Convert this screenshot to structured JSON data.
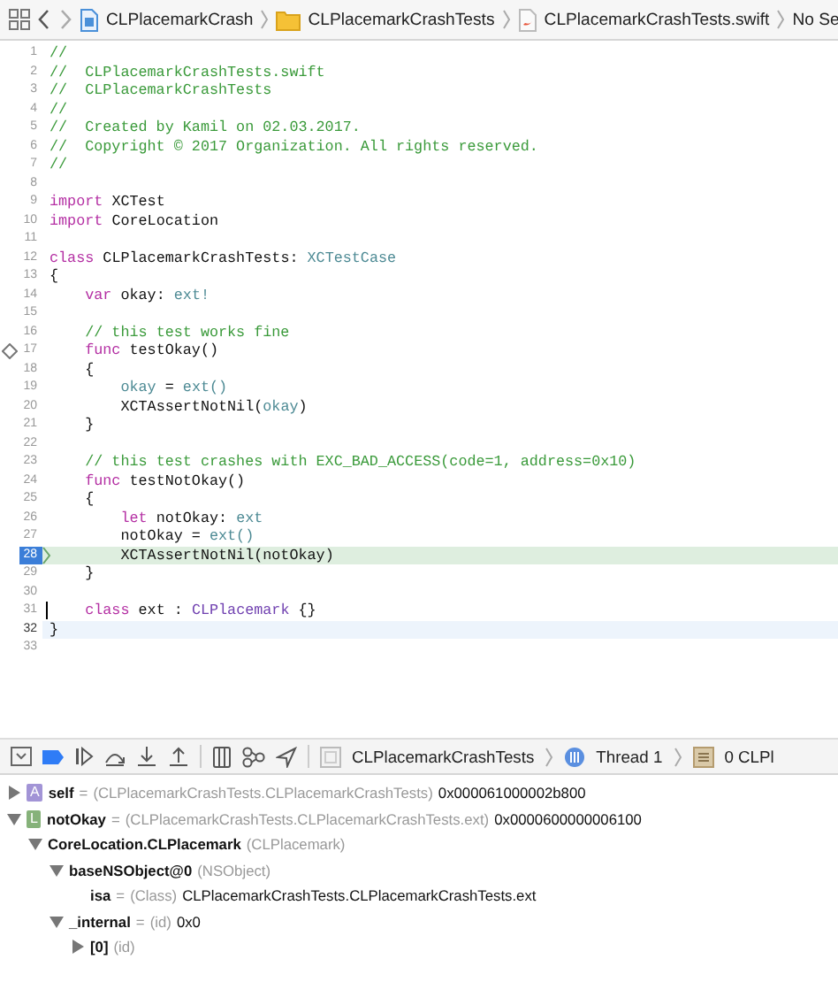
{
  "jump_bar": {
    "items": [
      {
        "kind": "project",
        "label": "CLPlacemarkCrash"
      },
      {
        "kind": "folder",
        "label": "CLPlacemarkCrashTests"
      },
      {
        "kind": "swift",
        "label": "CLPlacemarkCrashTests.swift"
      },
      {
        "kind": "plain",
        "label": "No Se"
      }
    ]
  },
  "editor": {
    "lines": [
      {
        "number": "1",
        "current": false,
        "focused": false,
        "test": false,
        "caret": false,
        "tokens": [
          {
            "kind": "comment",
            "text": "//"
          }
        ]
      },
      {
        "number": "2",
        "current": false,
        "focused": false,
        "test": false,
        "caret": false,
        "tokens": [
          {
            "kind": "comment",
            "text": "//  CLPlacemarkCrashTests.swift"
          }
        ]
      },
      {
        "number": "3",
        "current": false,
        "focused": false,
        "test": false,
        "caret": false,
        "tokens": [
          {
            "kind": "comment",
            "text": "//  CLPlacemarkCrashTests"
          }
        ]
      },
      {
        "number": "4",
        "current": false,
        "focused": false,
        "test": false,
        "caret": false,
        "tokens": [
          {
            "kind": "comment",
            "text": "//"
          }
        ]
      },
      {
        "number": "5",
        "current": false,
        "focused": false,
        "test": false,
        "caret": false,
        "tokens": [
          {
            "kind": "comment",
            "text": "//  Created by Kamil on 02.03.2017."
          }
        ]
      },
      {
        "number": "6",
        "current": false,
        "focused": false,
        "test": false,
        "caret": false,
        "tokens": [
          {
            "kind": "comment",
            "text": "//  Copyright © 2017 Organization. All rights reserved."
          }
        ]
      },
      {
        "number": "7",
        "current": false,
        "focused": false,
        "test": false,
        "caret": false,
        "tokens": [
          {
            "kind": "comment",
            "text": "//"
          }
        ]
      },
      {
        "number": "8",
        "current": false,
        "focused": false,
        "test": false,
        "caret": false
      },
      {
        "number": "9",
        "current": false,
        "focused": false,
        "test": false,
        "caret": false,
        "tokens": [
          {
            "kind": "keyword",
            "text": "import"
          },
          {
            "kind": "plain",
            "text": " XCTest"
          }
        ]
      },
      {
        "number": "10",
        "current": false,
        "focused": false,
        "test": false,
        "caret": false,
        "tokens": [
          {
            "kind": "keyword",
            "text": "import"
          },
          {
            "kind": "plain",
            "text": " CoreLocation"
          }
        ]
      },
      {
        "number": "11",
        "current": false,
        "focused": false,
        "test": false,
        "caret": false
      },
      {
        "number": "12",
        "current": false,
        "focused": false,
        "test": false,
        "caret": false,
        "tokens": [
          {
            "kind": "keyword",
            "text": "class"
          },
          {
            "kind": "plain",
            "text": " CLPlacemarkCrashTests:"
          },
          {
            "kind": "type",
            "text": " XCTestCase"
          }
        ]
      },
      {
        "number": "13",
        "current": false,
        "focused": false,
        "test": false,
        "caret": false,
        "tokens": [
          {
            "kind": "plain",
            "text": "{"
          }
        ]
      },
      {
        "number": "14",
        "current": false,
        "focused": false,
        "test": false,
        "caret": false,
        "tokens": [
          {
            "kind": "keyword",
            "text": "    var"
          },
          {
            "kind": "plain",
            "text": " okay:"
          },
          {
            "kind": "type",
            "text": " ext!"
          }
        ]
      },
      {
        "number": "15",
        "current": false,
        "focused": false,
        "test": false,
        "caret": false
      },
      {
        "number": "16",
        "current": false,
        "focused": false,
        "test": false,
        "caret": false,
        "tokens": [
          {
            "kind": "comment",
            "text": "    // this test works fine"
          }
        ]
      },
      {
        "number": "17",
        "current": false,
        "focused": false,
        "test": true,
        "caret": false,
        "tokens": [
          {
            "kind": "keyword",
            "text": "    func"
          },
          {
            "kind": "plain",
            "text": " testOkay()"
          }
        ]
      },
      {
        "number": "18",
        "current": false,
        "focused": false,
        "test": false,
        "caret": false,
        "tokens": [
          {
            "kind": "plain",
            "text": "    {"
          }
        ]
      },
      {
        "number": "19",
        "current": false,
        "focused": false,
        "test": false,
        "caret": false,
        "tokens": [
          {
            "kind": "type",
            "text": "        okay"
          },
          {
            "kind": "plain",
            "text": " ="
          },
          {
            "kind": "type",
            "text": " ext()"
          }
        ]
      },
      {
        "number": "20",
        "current": false,
        "focused": false,
        "test": false,
        "caret": false,
        "tokens": [
          {
            "kind": "plain",
            "text": "        XCTAssertNotNil("
          },
          {
            "kind": "type",
            "text": "okay"
          },
          {
            "kind": "plain",
            "text": ")"
          }
        ]
      },
      {
        "number": "21",
        "current": false,
        "focused": false,
        "test": false,
        "caret": false,
        "tokens": [
          {
            "kind": "plain",
            "text": "    }"
          }
        ]
      },
      {
        "number": "22",
        "current": false,
        "focused": false,
        "test": false,
        "caret": false
      },
      {
        "number": "23",
        "current": false,
        "focused": false,
        "test": false,
        "caret": false,
        "tokens": [
          {
            "kind": "comment",
            "text": "    // this test crashes with EXC_BAD_ACCESS(code=1, address=0x10)"
          }
        ]
      },
      {
        "number": "24",
        "current": false,
        "focused": false,
        "test": false,
        "caret": false,
        "tokens": [
          {
            "kind": "keyword",
            "text": "    func"
          },
          {
            "kind": "plain",
            "text": " testNotOkay()"
          }
        ]
      },
      {
        "number": "25",
        "current": false,
        "focused": false,
        "test": false,
        "caret": false,
        "tokens": [
          {
            "kind": "plain",
            "text": "    {"
          }
        ]
      },
      {
        "number": "26",
        "current": false,
        "focused": false,
        "test": false,
        "caret": false,
        "tokens": [
          {
            "kind": "keyword",
            "text": "        let"
          },
          {
            "kind": "plain",
            "text": " notOkay:"
          },
          {
            "kind": "type",
            "text": " ext"
          }
        ]
      },
      {
        "number": "27",
        "current": false,
        "focused": false,
        "test": false,
        "caret": false,
        "tokens": [
          {
            "kind": "plain",
            "text": "        notOkay ="
          },
          {
            "kind": "type",
            "text": " ext()"
          }
        ]
      },
      {
        "number": "28",
        "current": true,
        "focused": false,
        "test": false,
        "caret": false,
        "tokens": [
          {
            "kind": "plain",
            "text": "        XCTAssertNotNil(notOkay)"
          }
        ]
      },
      {
        "number": "29",
        "current": false,
        "focused": false,
        "test": false,
        "caret": false,
        "tokens": [
          {
            "kind": "plain",
            "text": "    }"
          }
        ]
      },
      {
        "number": "30",
        "current": false,
        "focused": false,
        "test": false,
        "caret": false
      },
      {
        "number": "31",
        "current": false,
        "focused": false,
        "test": false,
        "caret": true,
        "tokens": [
          {
            "kind": "keyword",
            "text": "    class"
          },
          {
            "kind": "plain",
            "text": " ext :"
          },
          {
            "kind": "class",
            "text": " CLPlacemark"
          },
          {
            "kind": "plain",
            "text": " {}"
          }
        ]
      },
      {
        "number": "32",
        "current": false,
        "focused": true,
        "test": false,
        "caret": false,
        "tokens": [
          {
            "kind": "plain",
            "text": "}"
          }
        ]
      },
      {
        "number": "33",
        "current": false,
        "focused": false,
        "test": false,
        "caret": false
      }
    ]
  },
  "debug_bar": {
    "path": [
      {
        "kind": "target",
        "label": "CLPlacemarkCrashTests"
      },
      {
        "kind": "thread",
        "label": "Thread 1"
      },
      {
        "kind": "frame",
        "label": "0 CLPl"
      }
    ]
  },
  "variables": [
    {
      "name": "self",
      "badge": "A",
      "color": "#a294d6",
      "separator": "=",
      "type": "(CLPlacemarkCrashTests.CLPlacemarkCrashTests)",
      "value": "0x000061000002b800",
      "expanded": false
    },
    {
      "name": "notOkay",
      "badge": "L",
      "color": "#86b27a",
      "separator": "=",
      "type": "(CLPlacemarkCrashTests.CLPlacemarkCrashTests.ext)",
      "value": "0x0000600000006100",
      "expanded": true,
      "children": [
        {
          "name": "CoreLocation.CLPlacemark",
          "type": "(CLPlacemark)",
          "expanded": true,
          "children": [
            {
              "name": "baseNSObject@0",
              "type": "(NSObject)",
              "expanded": true,
              "children": [
                {
                  "name": "isa",
                  "separator": "=",
                  "type": "(Class)",
                  "value": "CLPlacemarkCrashTests.CLPlacemarkCrashTests.ext"
                }
              ]
            },
            {
              "name": "_internal",
              "separator": "=",
              "type": "(id)",
              "value": "0x0",
              "expanded": true,
              "children": [
                {
                  "name": "[0]",
                  "type": "(id)",
                  "expanded": false
                }
              ]
            }
          ]
        }
      ]
    }
  ]
}
